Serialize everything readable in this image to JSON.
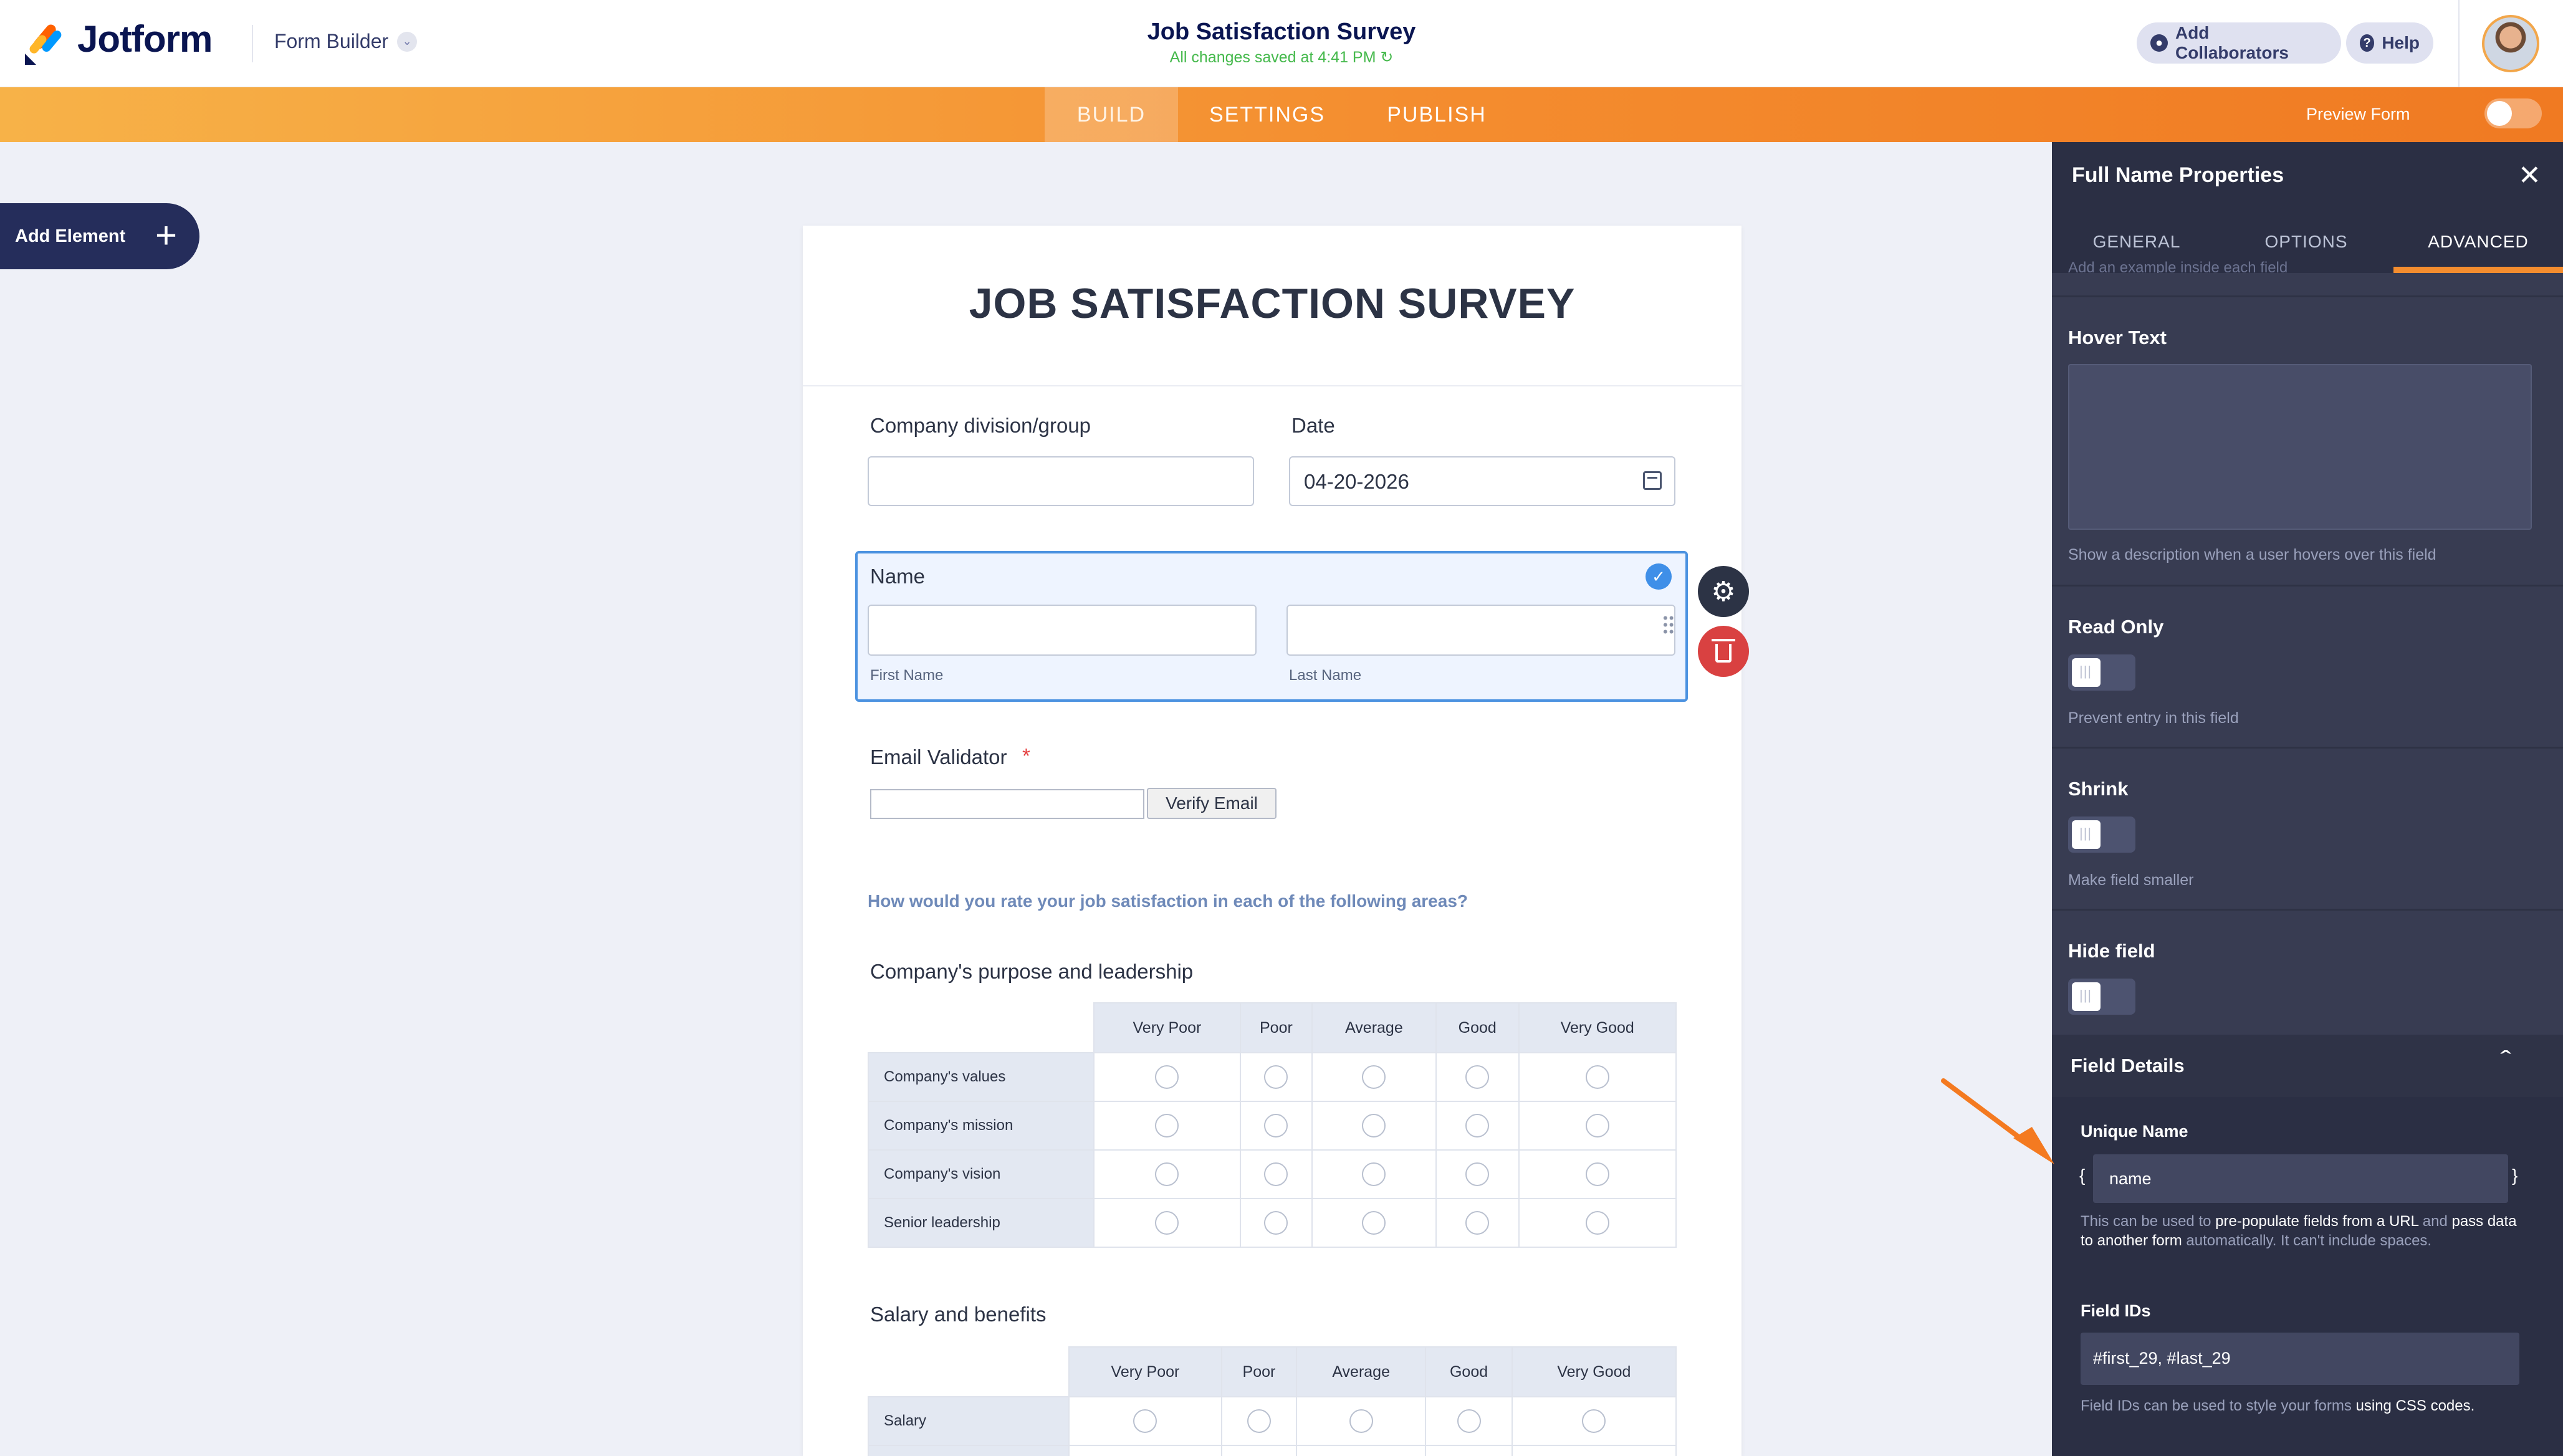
{
  "header": {
    "logo_text": "Jotform",
    "app_menu_label": "Form Builder",
    "form_title": "Job Satisfaction Survey",
    "save_status": "All changes saved at 4:41 PM",
    "add_collaborators_label": "Add Collaborators",
    "help_label": "Help"
  },
  "nav": {
    "tabs": [
      {
        "label": "BUILD",
        "active": true
      },
      {
        "label": "SETTINGS",
        "active": false
      },
      {
        "label": "PUBLISH",
        "active": false
      }
    ],
    "preview_label": "Preview Form",
    "preview_enabled": false
  },
  "add_element_label": "Add Element",
  "form": {
    "heading": "JOB SATISFACTION SURVEY",
    "division_label": "Company division/group",
    "division_value": "",
    "date_label": "Date",
    "date_value": "04-20-2026",
    "name_label": "Name",
    "first_name_sublabel": "First Name",
    "last_name_sublabel": "Last Name",
    "email_label": "Email Validator",
    "email_required_mark": "*",
    "verify_button": "Verify Email",
    "question": "How would you rate your job satisfaction in each of the following areas?",
    "section1": {
      "title": "Company's purpose and leadership",
      "columns": [
        "Very Poor",
        "Poor",
        "Average",
        "Good",
        "Very Good"
      ],
      "rows": [
        "Company's values",
        "Company's mission",
        "Company's vision",
        "Senior leadership"
      ]
    },
    "section2": {
      "title": "Salary and benefits",
      "columns": [
        "Very Poor",
        "Poor",
        "Average",
        "Good",
        "Very Good"
      ],
      "rows": [
        "Salary",
        ""
      ]
    }
  },
  "panel": {
    "title": "Full Name Properties",
    "tabs": [
      "GENERAL",
      "OPTIONS",
      "ADVANCED"
    ],
    "active_tab": "ADVANCED",
    "cut_off_text": "Add an example inside each field",
    "hover_text_label": "Hover Text",
    "hover_text_value": "",
    "hover_text_desc": "Show a description when a user hovers over this field",
    "read_only_label": "Read Only",
    "read_only_desc": "Prevent entry in this field",
    "shrink_label": "Shrink",
    "shrink_desc": "Make field smaller",
    "hide_field_label": "Hide field",
    "field_details_label": "Field Details",
    "unique_name_label": "Unique Name",
    "brace_open": "{",
    "brace_close": "}",
    "unique_name_value": "name",
    "unique_desc_1": "This can be used to ",
    "unique_desc_link1": "pre-populate fields from a URL",
    "unique_desc_2": " and ",
    "unique_desc_link2": "pass data to another form",
    "unique_desc_3": " automatically. It can't include spaces.",
    "field_ids_label": "Field IDs",
    "field_ids_value": "#first_29, #last_29",
    "field_ids_desc_1": "Field IDs can be used to style your forms ",
    "field_ids_desc_link": "using CSS codes."
  },
  "colors": {
    "brand_navy": "#0a1551",
    "nav_orange": "#f48d2f",
    "selected_border": "#4b92e0",
    "panel_bg": "#383c52",
    "delete_red": "#d94141",
    "saved_green": "#45b94c"
  },
  "icons": [
    "jotform-logo-icon",
    "chevron-down-icon",
    "user-icon",
    "question-icon",
    "plus-icon",
    "calendar-icon",
    "check-icon",
    "gear-icon",
    "trash-icon",
    "close-icon",
    "chevron-up-icon",
    "drag-handle-icon",
    "orange-arrow-pointer"
  ]
}
